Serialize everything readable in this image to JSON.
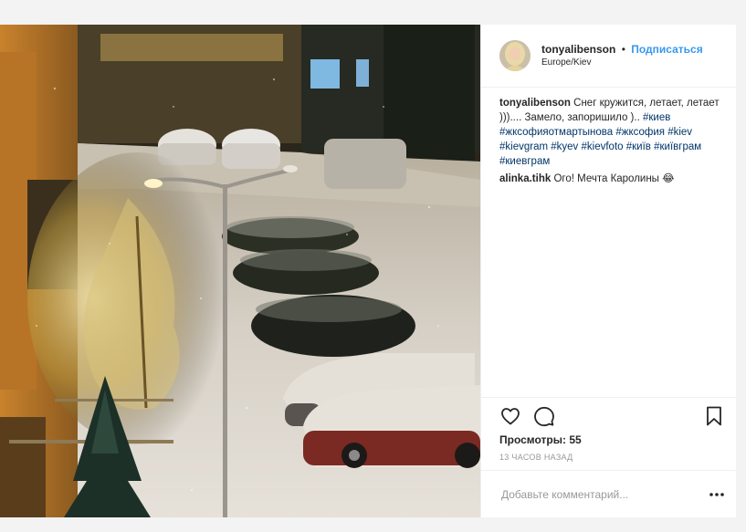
{
  "post": {
    "username": "tonyalibenson",
    "separator": "•",
    "follow_label": "Подписаться",
    "location": "Europe/Kiev"
  },
  "caption": {
    "user": "tonyalibenson",
    "text": "Снег кружится, летает, летает ))).... Замело, запоришило )..",
    "hashtags": [
      "#киев",
      "#жксофияотмартынова",
      "#жксофия",
      "#kiev",
      "#kievgram",
      "#kyev",
      "#kievfoto",
      "#київ",
      "#київграм",
      "#киевграм"
    ]
  },
  "comments": [
    {
      "user": "alinka.tihk",
      "text": "Ого! Мечта Каролины 😂"
    }
  ],
  "actions": {
    "icons": [
      "heart-icon",
      "comment-bubble-icon",
      "bookmark-icon"
    ],
    "views_label": "Просмотры: 55",
    "timestamp": "13 часов назад"
  },
  "add_comment": {
    "placeholder": "Добавьте комментарий..."
  },
  "colors": {
    "link_blue": "#3897f0",
    "hashtag": "#003569",
    "muted": "#999999",
    "border": "#efefef"
  }
}
